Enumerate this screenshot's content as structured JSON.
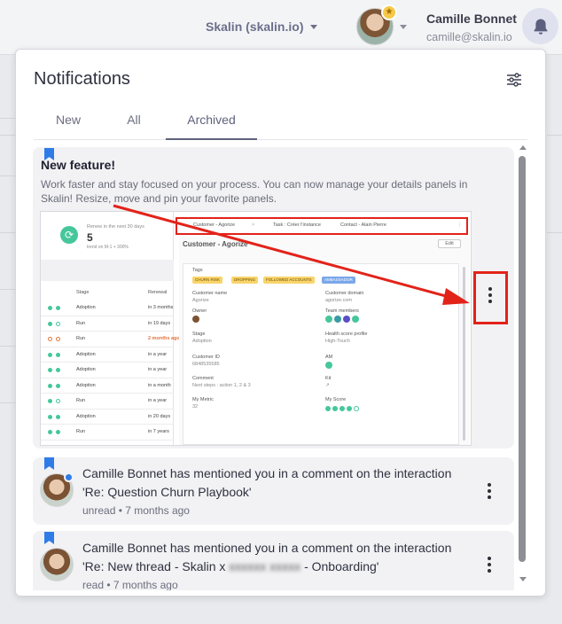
{
  "header": {
    "org_name": "Skalin (skalin.io)",
    "user_name": "Camille Bonnet",
    "user_email": "camille@skalin.io",
    "icons": {
      "bell": "bell-icon",
      "trophy": "trophy-icon",
      "caret": "chevron-down-icon"
    }
  },
  "panel": {
    "title": "Notifications",
    "tabs": [
      {
        "label": "New"
      },
      {
        "label": "All"
      },
      {
        "label": "Archived"
      }
    ],
    "active_tab": "Archived",
    "accent_color": "#2f7ce8"
  },
  "feature": {
    "title": "New feature!",
    "body": "Work faster and stay focused on your process. You can now manage your details panels in Skalin! Resize, move and pin your favorite panels.",
    "screenshot": {
      "stat_label": "Renew in the next 30 days",
      "stat_value": "5",
      "stat_trend": "trend on M-1 + 300%",
      "col_stage": "Stage",
      "col_renewal": "Renewal",
      "rows": [
        {
          "stage": "Adoption",
          "renewal": "in 3 months",
          "dots": "green"
        },
        {
          "stage": "Run",
          "renewal": "in 19 days",
          "dots": "green"
        },
        {
          "stage": "Run",
          "renewal": "2 months ago",
          "dots": "orange"
        },
        {
          "stage": "Adoption",
          "renewal": "in a year",
          "dots": "green"
        },
        {
          "stage": "Adoption",
          "renewal": "in a year",
          "dots": "green"
        },
        {
          "stage": "Adoption",
          "renewal": "in a month",
          "dots": "green"
        },
        {
          "stage": "Run",
          "renewal": "in a year",
          "dots": "green"
        },
        {
          "stage": "Adoption",
          "renewal": "in 20 days",
          "dots": "green"
        },
        {
          "stage": "Run",
          "renewal": "in 7 years",
          "dots": "green"
        }
      ],
      "tab1": "Customer - Agorize",
      "tab2": "Task : Créer l'instance",
      "tab3": "Contact - Alain Pierre",
      "panel_title": "Customer - Agorize",
      "edit_label": "Edit",
      "tags_label": "Tags",
      "tags": [
        "CHURN RISK",
        "DROPPING",
        "FOLLOWED ACCOUNTS",
        "AMBASSADOR"
      ],
      "customer_name_label": "Customer name",
      "customer_name": "Agorize",
      "customer_domain_label": "Customer domain",
      "customer_domain": "agorize.com",
      "owner_label": "Owner",
      "team_label": "Team members",
      "stage_label": "Stage",
      "stage_value": "Adoption",
      "health_label": "Health score profile",
      "health_value": "High-Touch",
      "customer_id_label": "Customer ID",
      "customer_id": "6848535585",
      "am_label": "AM",
      "comment_label": "Comment",
      "comment_value": "Next steps : action 1, 2 & 3",
      "kit_label": "Kit",
      "metric_label": "My Metric",
      "metric_value": "32",
      "score_label": "My Score"
    }
  },
  "notifications": [
    {
      "text_line1": "Camille Bonnet has mentioned you in a comment on the interaction",
      "text_line2": "'Re: Question Churn Playbook'",
      "status": "unread",
      "time": "7 months ago",
      "unread": true
    },
    {
      "text_line1": "Camille Bonnet has mentioned you in a comment on the interaction",
      "text_line2_start": "'Re: New thread - Skalin x",
      "text_line2_blur": "xxxxxx xxxxx",
      "text_line2_end": "- Onboarding'",
      "status": "read",
      "time": "7 months ago",
      "unread": false
    }
  ]
}
